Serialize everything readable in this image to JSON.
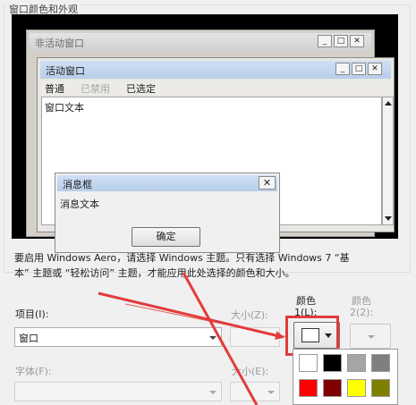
{
  "group_caption": "窗口颜色和外观",
  "preview": {
    "inactive_title": "非活动窗口",
    "active_title": "活动窗口",
    "menu": {
      "normal": "普通",
      "disabled": "已禁用",
      "selected": "已选定"
    },
    "window_text": "窗口文本",
    "message_box": {
      "title": "消息框",
      "text": "消息文本",
      "ok": "确定"
    }
  },
  "description_line1": "要启用 Windows Aero，请选择 Windows 主题。只有选择 Windows 7 “基",
  "description_line2": "本” 主题或 “轻松访问” 主题，才能应用此处选择的颜色和大小。",
  "form": {
    "item_label": "项目(I):",
    "item_value": "窗口",
    "size_label": "大小(Z):",
    "color1_label_line1": "颜色",
    "color1_label_line2": "1(L):",
    "color2_label_line1": "颜色",
    "color2_label_line2": "2(2):",
    "font_label": "字体(F):",
    "font_size_label": "大小(E):"
  },
  "caption_buttons": {
    "minimize": "_",
    "maximize": "□",
    "close": "✕"
  },
  "palette_colors": [
    "#ffffff",
    "#000000",
    "#a5a5a5",
    "#7f7f7f",
    "#ff0000",
    "#800000",
    "#ffff00",
    "#808000"
  ],
  "annotation_color": "#e23b3b"
}
